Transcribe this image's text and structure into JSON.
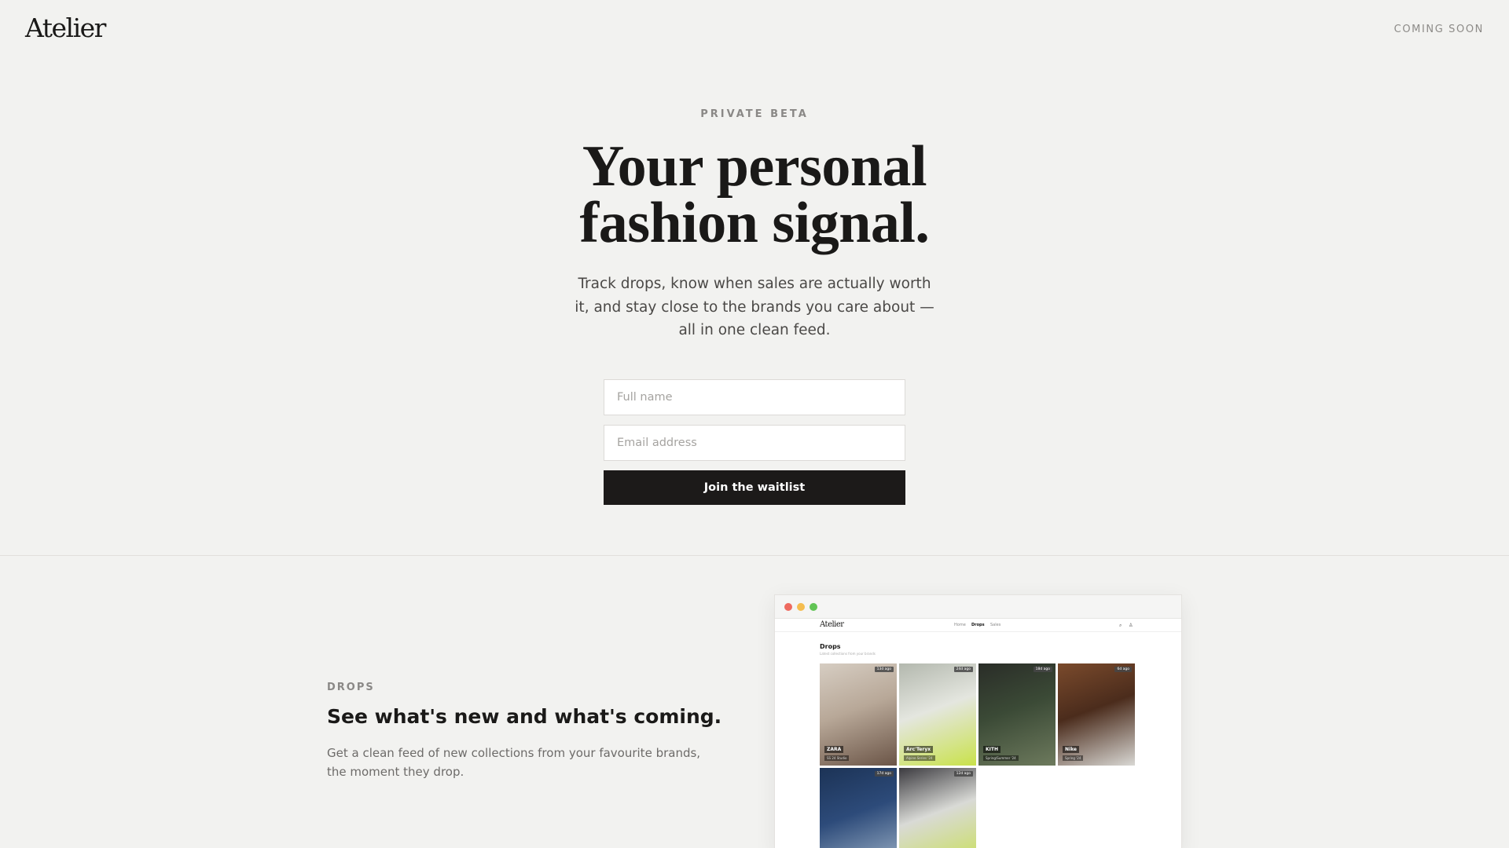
{
  "header": {
    "logo": "Atelier",
    "status": "COMING SOON"
  },
  "hero": {
    "eyebrow": "PRIVATE BETA",
    "title_line1": "Your personal",
    "title_line2": "fashion signal.",
    "subtitle": "Track drops, know when sales are actually worth it, and stay close to the brands you care about — all in one clean feed.",
    "name_placeholder": "Full name",
    "email_placeholder": "Email address",
    "cta_label": "Join the waitlist"
  },
  "feature": {
    "eyebrow": "DROPS",
    "title": "See what's new and what's coming.",
    "description": "Get a clean feed of new collections from your favourite brands, the moment they drop."
  },
  "mockup": {
    "window_dots": [
      "#ee6a5f",
      "#f5bd4f",
      "#61c454"
    ],
    "app_logo": "Atelier",
    "nav": [
      "Home",
      "Drops",
      "Sales"
    ],
    "nav_active": "Drops",
    "page_title": "Drops",
    "page_subtitle": "Latest collections from your brands",
    "cards": [
      {
        "brand": "ZARA",
        "meta": "SS 24 Studio",
        "badge": "13d ago",
        "palette": [
          "#b8a898",
          "#6b5547",
          "#d6cdc2"
        ]
      },
      {
        "brand": "Arc'Teryx",
        "meta": "Alpine Series '24",
        "badge": "24d ago",
        "palette": [
          "#e4e6df",
          "#c9e24a",
          "#b3b8ae"
        ]
      },
      {
        "brand": "KITH",
        "meta": "Spring/Summer '24",
        "badge": "18d ago",
        "palette": [
          "#3b4a36",
          "#6d7a5d",
          "#2a2d28"
        ]
      },
      {
        "brand": "Nike",
        "meta": "Spring '24",
        "badge": "6d ago",
        "palette": [
          "#4b2c1c",
          "#d9d8d4",
          "#7a4a2c"
        ]
      },
      {
        "brand": "",
        "meta": "",
        "badge": "17d ago",
        "palette": [
          "#2d4b7a",
          "#9fb3c8",
          "#1c3356"
        ]
      },
      {
        "brand": "",
        "meta": "",
        "badge": "12d ago",
        "palette": [
          "#d9dad6",
          "#c8e050",
          "#3b3a3f"
        ]
      }
    ]
  }
}
